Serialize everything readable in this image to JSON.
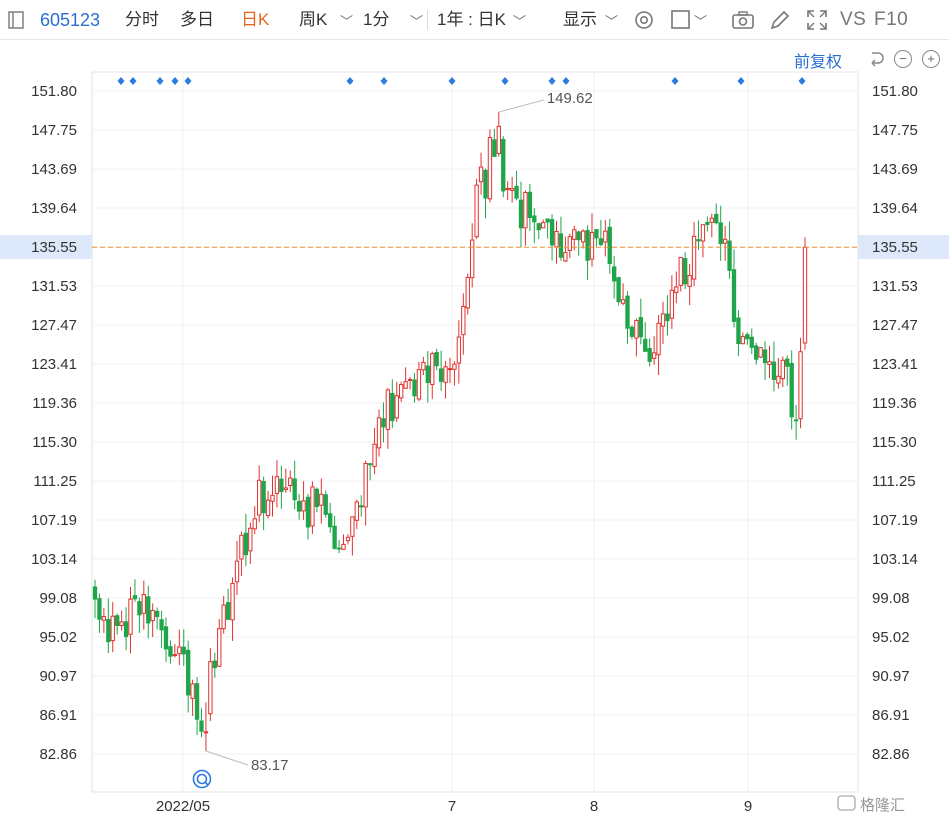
{
  "toolbar": {
    "stock_code": "605123",
    "tabs": [
      "分时",
      "多日",
      "日K",
      "周K",
      "1分"
    ],
    "active_tab": "日K",
    "range_select": "1年 : 日K",
    "display_label": "显示",
    "vs_label": "VS",
    "f10_label": "F10",
    "icons": [
      "sidebar-icon",
      "settings-icon",
      "checkbox-icon",
      "camera-icon",
      "pen-icon",
      "fullscreen-icon"
    ]
  },
  "adjust": {
    "label": "前复权",
    "buttons": [
      "undo-icon",
      "zoom-out-icon",
      "zoom-in-icon"
    ]
  },
  "chart_data": {
    "type": "candlestick",
    "y_ticks": [
      "151.80",
      "147.75",
      "143.69",
      "139.64",
      "135.55",
      "131.53",
      "127.47",
      "123.41",
      "119.36",
      "115.30",
      "111.25",
      "107.19",
      "103.14",
      "99.08",
      "95.02",
      "90.97",
      "86.91",
      "82.86"
    ],
    "x_ticks": [
      "2022/05",
      "7",
      "8",
      "9"
    ],
    "current_price": 135.55,
    "annotations": {
      "high": "149.62",
      "low": "83.17"
    },
    "colors": {
      "up": "#e0322f",
      "down": "#1fa54a",
      "current_line": "#f0922a",
      "current_bg": "#dde9fb",
      "marker": "#2b7be0"
    }
  },
  "watermark": "格隆汇"
}
